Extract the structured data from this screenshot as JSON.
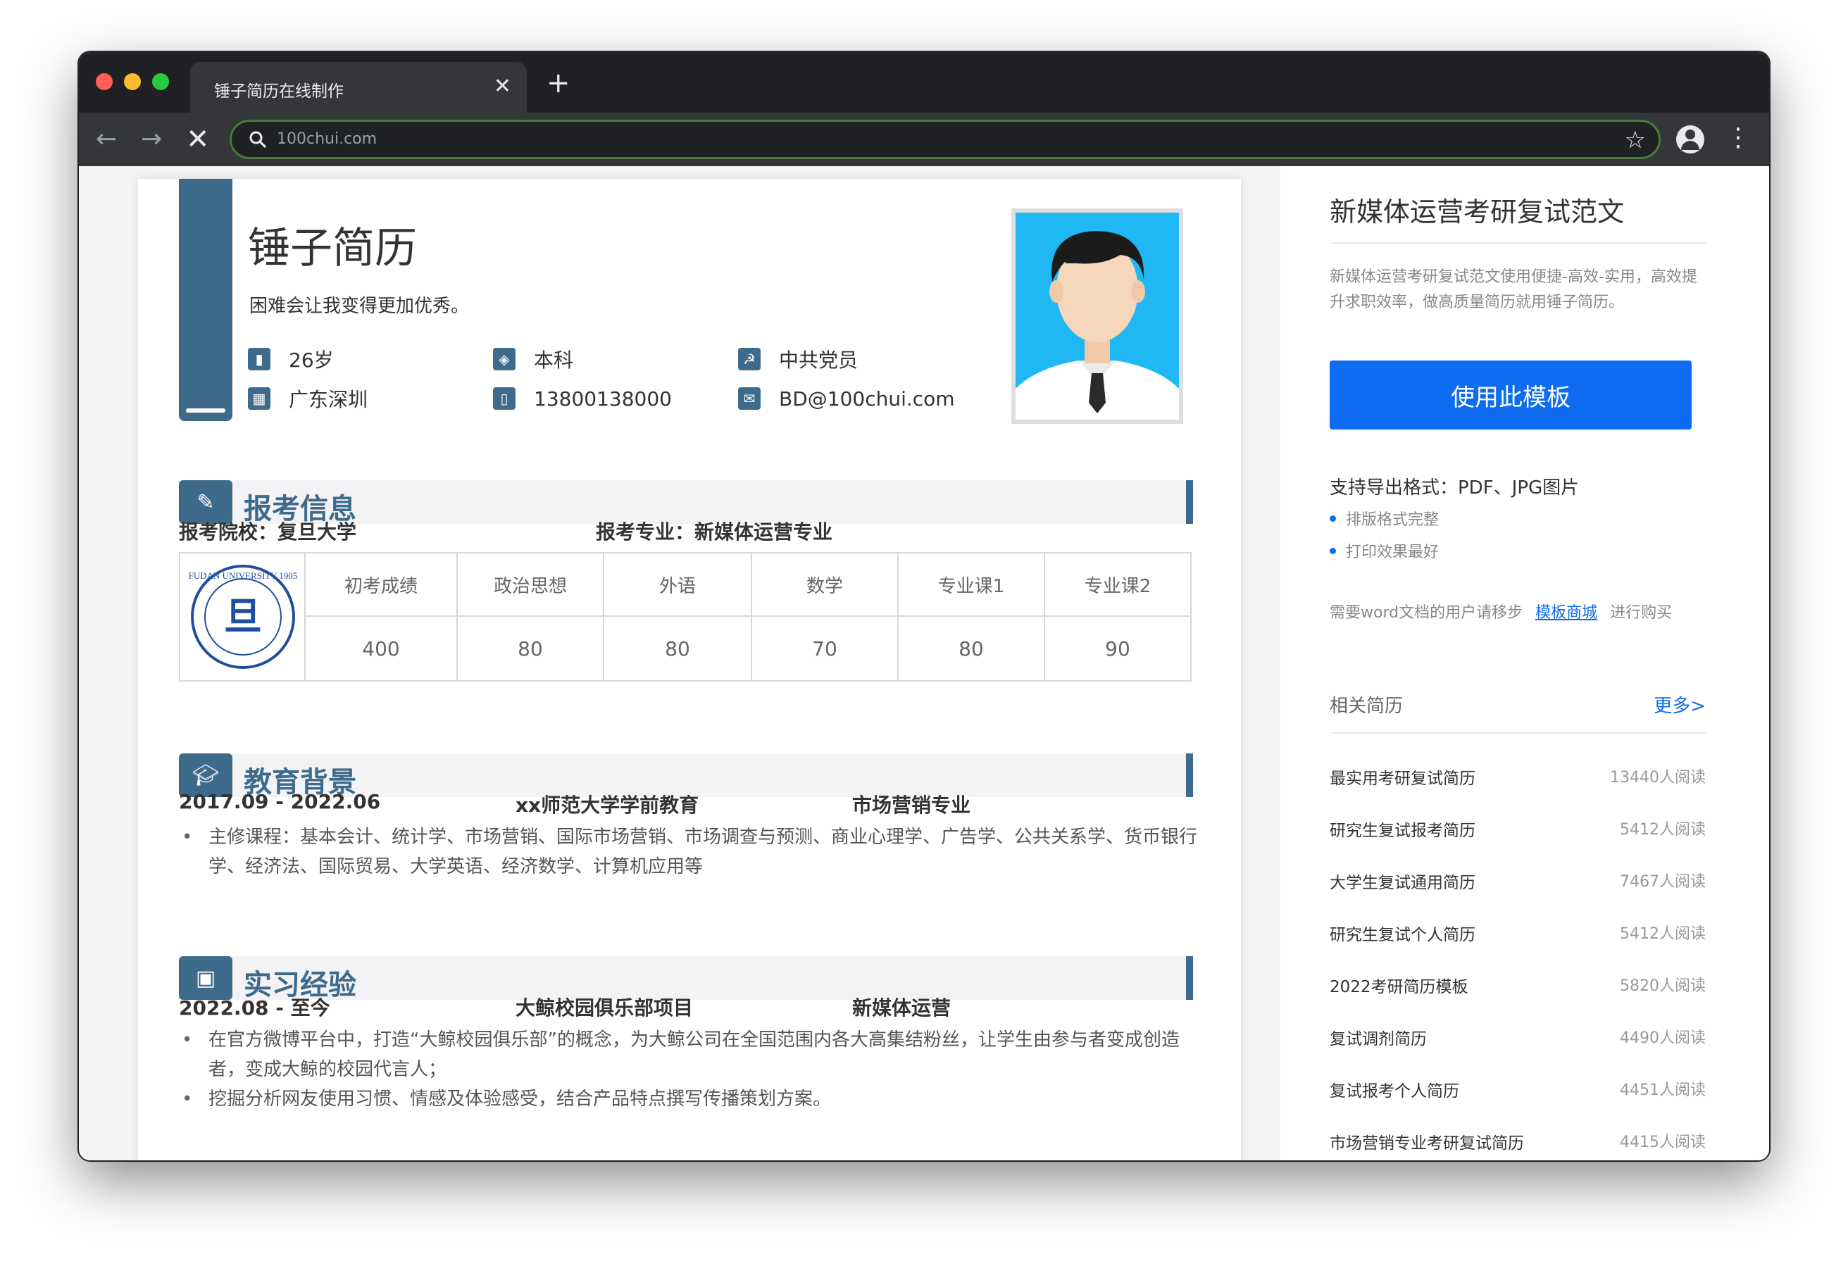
{
  "browser": {
    "tab_title": "锤子简历在线制作",
    "tab_close": "✕",
    "new_tab": "+",
    "url": "100chui.com",
    "back": "←",
    "forward": "→",
    "stop": "✕",
    "star": "☆",
    "menu": "⋮"
  },
  "resume": {
    "name": "锤子简历",
    "motto": "困难会让我变得更加优秀。",
    "info": [
      {
        "icon": "bar-chart-icon",
        "text": "26岁"
      },
      {
        "icon": "graduation-icon",
        "text": "本科"
      },
      {
        "icon": "party-badge-icon",
        "text": "中共党员"
      },
      {
        "icon": "building-icon",
        "text": "广东深圳"
      },
      {
        "icon": "phone-icon",
        "text": "13800138000"
      },
      {
        "icon": "mail-icon",
        "text": "BD@100chui.com"
      }
    ],
    "sections": {
      "exam": {
        "title": "报考信息",
        "school": "报考院校：复旦大学",
        "major": "报考专业：新媒体运营专业",
        "logo_text": "FUDAN UNIVERSITY 1905",
        "headers": [
          "初考成绩",
          "政治思想",
          "外语",
          "数学",
          "专业课1",
          "专业课2"
        ],
        "values": [
          "400",
          "80",
          "80",
          "70",
          "80",
          "90"
        ]
      },
      "education": {
        "title": "教育背景",
        "period": "2017.09 - 2022.06",
        "school": "xx师范大学学前教育",
        "major": "市场营销专业",
        "bullets": [
          "主修课程：基本会计、统计学、市场营销、国际市场营销、市场调查与预测、商业心理学、广告学、公共关系学、货币银行学、经济法、国际贸易、大学英语、经济数学、计算机应用等"
        ]
      },
      "internship": {
        "title": "实习经验",
        "period": "2022.08 - 至今",
        "project": "大鲸校园俱乐部项目",
        "role": "新媒体运营",
        "bullets": [
          "在官方微博平台中，打造“大鲸校园俱乐部”的概念，为大鲸公司在全国范围内各大高集结粉丝，让学生由参与者变成创造者，变成大鲸的校园代言人；",
          "挖掘分析网友使用习惯、情感及体验感受，结合产品特点撰写传播策划方案。"
        ]
      }
    }
  },
  "sidebar": {
    "title": "新媒体运营考研复试范文",
    "description": "新媒体运营考研复试范文使用便捷-高效-实用，高效提升求职效率，做高质量简历就用锤子简历。",
    "use_button": "使用此模板",
    "formats": "支持导出格式：PDF、JPG图片",
    "features": [
      "排版格式完整",
      "打印效果最好"
    ],
    "word_prefix": "需要word文档的用户请移步",
    "word_link": "模板商城",
    "word_suffix": "进行购买",
    "related_title": "相关简历",
    "more": "更多>",
    "related": [
      {
        "name": "最实用考研复试简历",
        "count": "13440人阅读"
      },
      {
        "name": "研究生复试报考简历",
        "count": "5412人阅读"
      },
      {
        "name": "大学生复试通用简历",
        "count": "7467人阅读"
      },
      {
        "name": "研究生复试个人简历",
        "count": "5412人阅读"
      },
      {
        "name": "2022考研简历模板",
        "count": "5820人阅读"
      },
      {
        "name": "复试调剂简历",
        "count": "4490人阅读"
      },
      {
        "name": "复试报考个人简历",
        "count": "4451人阅读"
      },
      {
        "name": "市场营销专业考研复试简历",
        "count": "4415人阅读"
      }
    ]
  },
  "colors": {
    "accent": "#3e6b8c",
    "primary_button": "#0d6cf2",
    "photo_bg": "#1fb8f5"
  }
}
